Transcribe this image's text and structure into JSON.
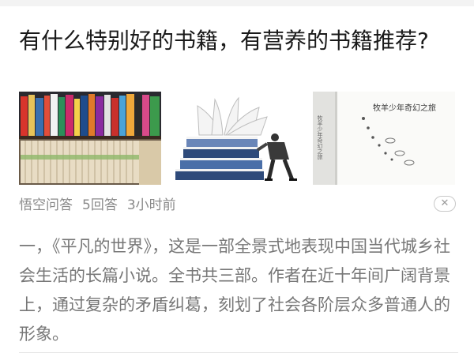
{
  "article": {
    "title": "有什么特别好的书籍，有营养的书籍推荐?",
    "thumbnails": [
      {
        "icon": "bookshelf-photo-icon"
      },
      {
        "icon": "book-stack-photo-icon"
      },
      {
        "icon": "book-cover-photo-icon",
        "cover_title": "牧羊少年奇幻之旅",
        "spine_text": "牧羊少年奇幻之旅"
      }
    ],
    "meta": {
      "source": "悟空问答",
      "answers": "5回答",
      "time": "3小时前"
    },
    "close_label": "✕",
    "excerpt": "一，《平凡的世界》，这是一部全景式地表现中国当代城乡社会生活的长篇小说。全书共三部。作者在近十年间广阔背景上，通过复杂的矛盾纠葛，刻划了社会各阶层众多普通人的形象。"
  }
}
